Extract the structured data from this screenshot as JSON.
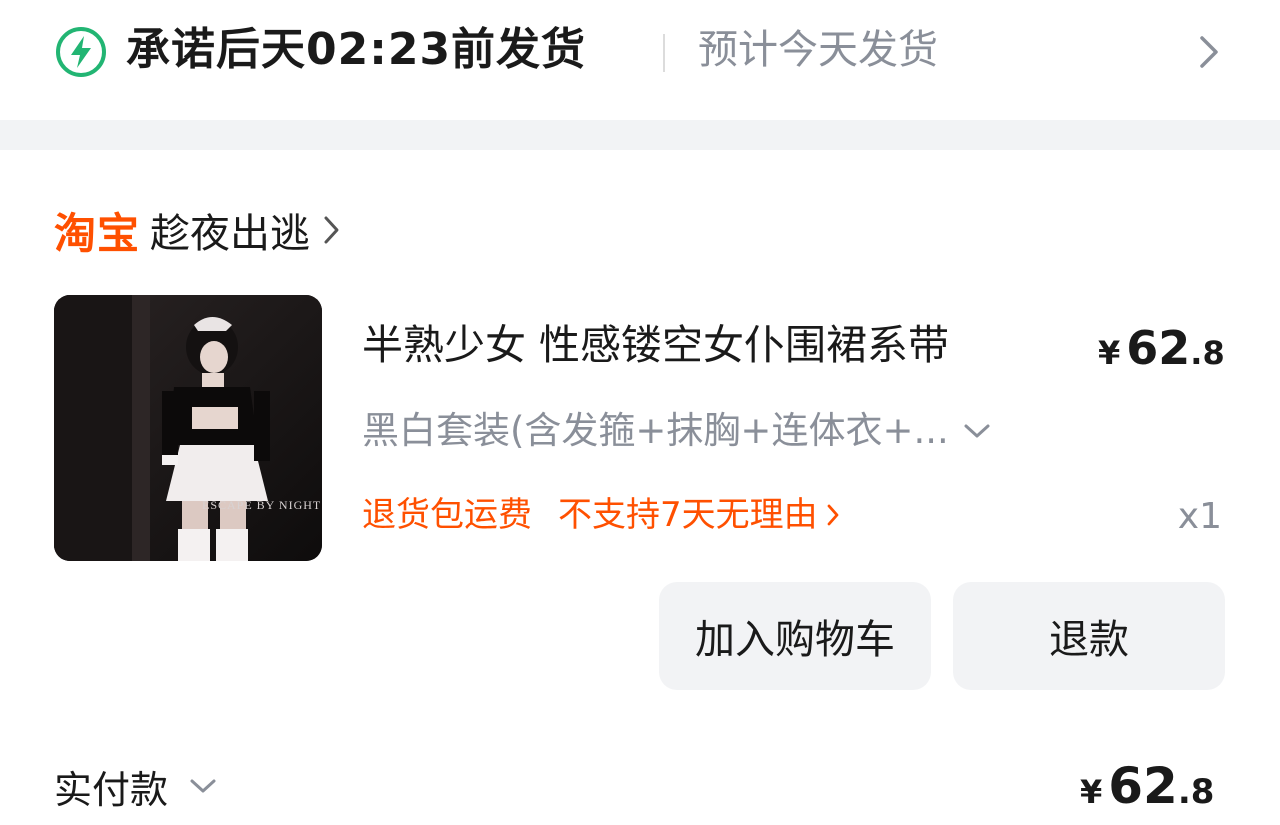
{
  "shipping": {
    "promise": "承诺后天02:23前发货",
    "estimate": "预计今天发货",
    "icon": "lightning-icon",
    "accent_color": "#22b573"
  },
  "store": {
    "platform_logo": "淘宝",
    "name": "趁夜出逃",
    "logo_color": "#ff5000"
  },
  "product": {
    "image_text": "ESCAPE BY NIGHT",
    "title": "半熟少女 性感镂空女仆围裙系带",
    "price_symbol": "¥",
    "price_int": "62",
    "price_dec": ".8",
    "sku": "黑白套装(含发箍+抹胸+连体衣+...",
    "service_tags": [
      "退货包运费",
      "不支持7天无理由"
    ],
    "quantity": "x1"
  },
  "actions": {
    "add_to_cart": "加入购物车",
    "refund": "退款"
  },
  "payment": {
    "label": "实付款",
    "symbol": "¥",
    "amount_int": "62",
    "amount_dec": ".8"
  }
}
